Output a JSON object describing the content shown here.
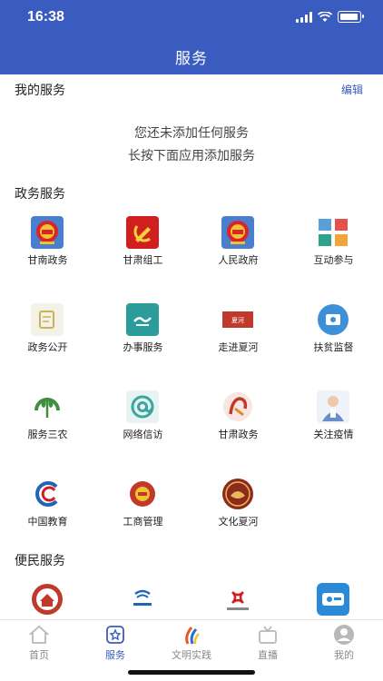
{
  "status_bar": {
    "time": "16:38"
  },
  "header": {
    "title": "服务"
  },
  "my_services": {
    "title": "我的服务",
    "edit_label": "编辑",
    "empty_line1": "您还未添加任何服务",
    "empty_line2": "长按下面应用添加服务"
  },
  "gov_services": {
    "title": "政务服务",
    "items": [
      {
        "label": "甘南政务",
        "icon": "national-emblem-icon",
        "color": "#d8252b"
      },
      {
        "label": "甘肃组工",
        "icon": "party-emblem-icon",
        "color": "#d11f1f"
      },
      {
        "label": "人民政府",
        "icon": "national-emblem-icon",
        "color": "#d8252b"
      },
      {
        "label": "互动参与",
        "icon": "interaction-grid-icon",
        "color": "#4a90c8"
      },
      {
        "label": "政务公开",
        "icon": "notebook-icon",
        "color": "#c8b25c"
      },
      {
        "label": "办事服务",
        "icon": "handshake-icon",
        "color": "#2b9c9a"
      },
      {
        "label": "走进夏河",
        "icon": "xiahe-banner-icon",
        "color": "#c0392b"
      },
      {
        "label": "扶贫监督",
        "icon": "supervision-icon",
        "color": "#3d8fd6"
      },
      {
        "label": "服务三农",
        "icon": "wheat-icon",
        "color": "#3f8f3f"
      },
      {
        "label": "网络信访",
        "icon": "at-sign-icon",
        "color": "#3aa6a0"
      },
      {
        "label": "甘肃政务",
        "icon": "gansu-logo-icon",
        "color": "#c0392b"
      },
      {
        "label": "关注疫情",
        "icon": "doctor-icon",
        "color": "#6a8fc8"
      },
      {
        "label": "中国教育",
        "icon": "education-logo-icon",
        "color": "#1f64b8"
      },
      {
        "label": "工商管理",
        "icon": "commerce-emblem-icon",
        "color": "#c0392b"
      },
      {
        "label": "文化夏河",
        "icon": "culture-seal-icon",
        "color": "#8e2a1c"
      }
    ]
  },
  "public_services": {
    "title": "便民服务",
    "items": [
      {
        "label": "",
        "icon": "house-seal-icon",
        "color": "#c0392b"
      },
      {
        "label": "",
        "icon": "china-telecom-icon",
        "color": "#1f64b8"
      },
      {
        "label": "",
        "icon": "china-unicom-icon",
        "color": "#d11f1f"
      },
      {
        "label": "",
        "icon": "violation-query-icon",
        "color": "#2a8ad8"
      }
    ]
  },
  "tabbar": {
    "items": [
      {
        "label": "首页",
        "icon": "home-icon"
      },
      {
        "label": "服务",
        "icon": "services-icon",
        "active": true
      },
      {
        "label": "文明实践",
        "icon": "civilization-icon"
      },
      {
        "label": "直播",
        "icon": "live-icon"
      },
      {
        "label": "我的",
        "icon": "profile-icon"
      }
    ]
  }
}
